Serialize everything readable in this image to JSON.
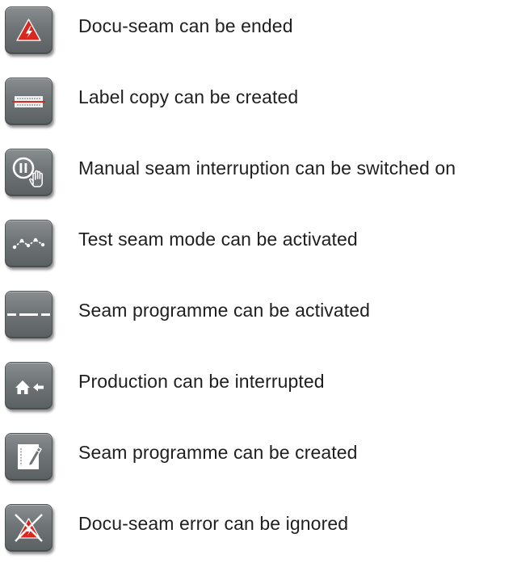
{
  "items": [
    {
      "icon": "docu-seam-end-icon",
      "label": "Docu-seam can be ended"
    },
    {
      "icon": "label-copy-icon",
      "label": "Label copy can be created"
    },
    {
      "icon": "manual-seam-interruption-icon",
      "label": "Manual seam interruption can be switched on"
    },
    {
      "icon": "test-seam-mode-icon",
      "label": "Test seam mode can be activated"
    },
    {
      "icon": "seam-programme-icon",
      "label": "Seam programme can be activated"
    },
    {
      "icon": "production-interrupt-icon",
      "label": "Production can be interrupted"
    },
    {
      "icon": "seam-programme-create-icon",
      "label": "Seam programme can be created"
    },
    {
      "icon": "docu-seam-error-ignore-icon",
      "label": "Docu-seam error can be ignored"
    }
  ],
  "colors": {
    "button_face": "#6f7477",
    "warning_red": "#d8271f",
    "label_text": "#1f1f1f"
  }
}
